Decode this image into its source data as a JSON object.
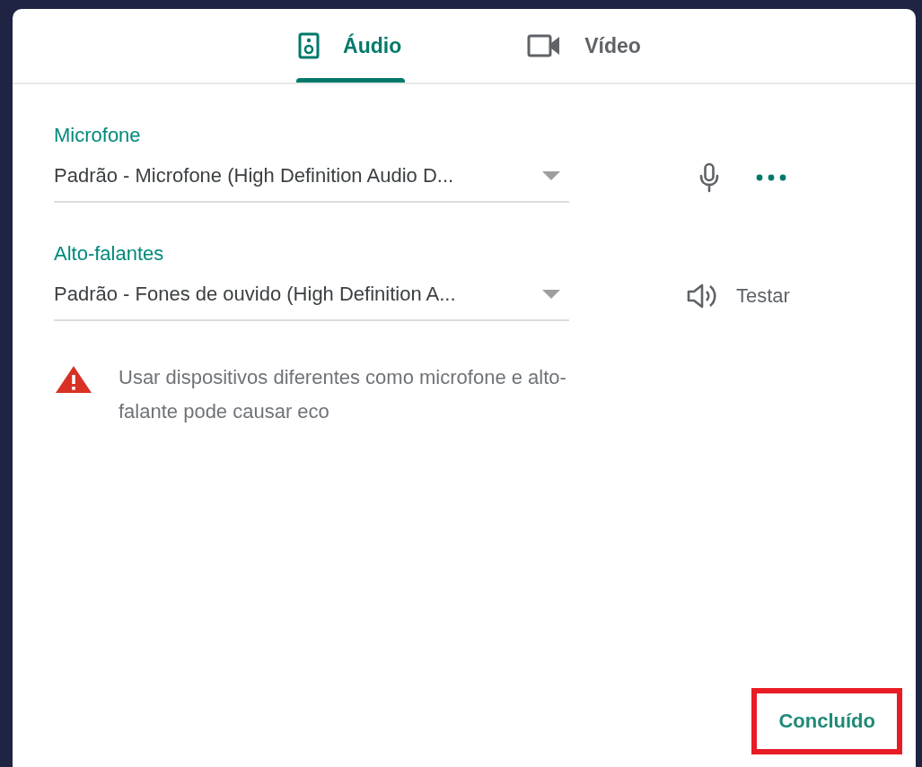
{
  "tabs": [
    {
      "label": "Áudio",
      "kind": "audio",
      "selected": true
    },
    {
      "label": "Vídeo",
      "kind": "video",
      "selected": false
    }
  ],
  "devices": [
    {
      "label": "Microfone",
      "value": "Padrão - Microfone (High Definition Audio D...",
      "kind": "microphone"
    },
    {
      "label": "Alto-falantes",
      "value": "Padrão - Fones de ouvido (High Definition A...",
      "kind": "speakers",
      "action": "Testar"
    }
  ],
  "warning": "Usar dispositivos diferentes como microfone e alto-falante pode causar eco",
  "done_button": {
    "label": "Concluído",
    "highlighted": true
  }
}
